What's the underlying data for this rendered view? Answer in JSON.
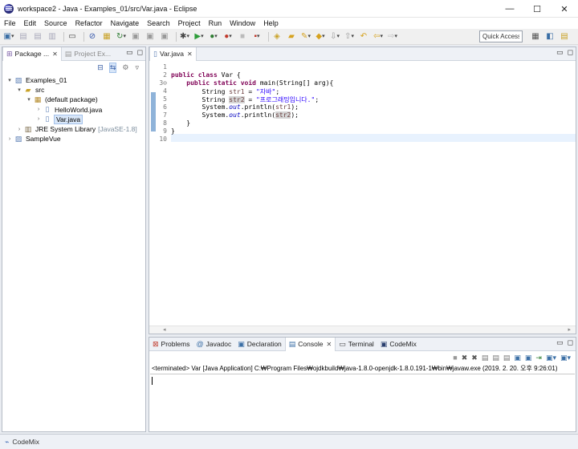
{
  "window": {
    "title": "workspace2 - Java - Examples_01/src/Var.java - Eclipse",
    "controls": [
      "—",
      "☐",
      "✕"
    ]
  },
  "menu": [
    "File",
    "Edit",
    "Source",
    "Refactor",
    "Navigate",
    "Search",
    "Project",
    "Run",
    "Window",
    "Help"
  ],
  "toolbar": {
    "quick_access": "Quick Access"
  },
  "package_explorer": {
    "tabs": [
      {
        "label": "Package ...",
        "active": true
      },
      {
        "label": "Project Ex...",
        "active": false
      }
    ],
    "tree": [
      {
        "label": "Examples_01",
        "icon": "project-icon",
        "twisty": "▾",
        "level": 0
      },
      {
        "label": "src",
        "icon": "source-folder-icon",
        "twisty": "▾",
        "level": 1
      },
      {
        "label": "(default package)",
        "icon": "package-icon",
        "twisty": "▾",
        "level": 2
      },
      {
        "label": "HelloWorld.java",
        "icon": "java-file-icon",
        "twisty": "›",
        "level": 3
      },
      {
        "label": "Var.java",
        "icon": "java-file-icon",
        "twisty": "›",
        "level": 3,
        "selected": true
      },
      {
        "label": "JRE System Library",
        "suffix": "[JavaSE-1.8]",
        "icon": "library-icon",
        "twisty": "›",
        "level": 1
      },
      {
        "label": "SampleVue",
        "icon": "project-icon",
        "twisty": "›",
        "level": 0
      }
    ]
  },
  "editor": {
    "tab_label": "Var.java",
    "line_numbers": [
      "1",
      "2",
      "3⊖",
      "4",
      "5",
      "6",
      "7",
      "8",
      "9",
      "10"
    ],
    "code": {
      "l2_kw1": "public",
      "l2_kw2": "class",
      "l2_rest": " Var {",
      "l3_kw1": "public",
      "l3_kw2": "static",
      "l3_kw3": "void",
      "l3_rest": " main(String[] arg){",
      "l4_a": "String ",
      "l4_var": "str1",
      "l4_b": " = ",
      "l4_str": "\"자바\"",
      "l4_c": ";",
      "l5_a": "String ",
      "l5_var": "str2",
      "l5_b": " = ",
      "l5_str": "\"프로그래밍입니다.\"",
      "l5_c": ";",
      "l6_a": "System.",
      "l6_fld": "out",
      "l6_b": ".println(",
      "l6_var": "str1",
      "l6_c": ");",
      "l7_a": "System.",
      "l7_fld": "out",
      "l7_b": ".println(",
      "l7_var": "str2",
      "l7_c": ");",
      "l8": "}",
      "l9": "}"
    }
  },
  "bottom_panel": {
    "tabs": [
      {
        "label": "Problems",
        "icon": "problems-icon",
        "active": false
      },
      {
        "label": "Javadoc",
        "icon": "javadoc-icon",
        "active": false
      },
      {
        "label": "Declaration",
        "icon": "declaration-icon",
        "active": false
      },
      {
        "label": "Console",
        "icon": "console-icon",
        "active": true
      },
      {
        "label": "Terminal",
        "icon": "terminal-icon",
        "active": false
      },
      {
        "label": "CodeMix",
        "icon": "codemix-icon",
        "active": false
      }
    ],
    "console_description": "<terminated> Var [Java Application] C:₩Program Files₩ojdkbuild₩java-1.8.0-openjdk-1.8.0.191-1₩bin₩javaw.exe (2019. 2. 20. 오후 9:26:01)"
  },
  "status_bar": {
    "label": "CodeMix"
  }
}
